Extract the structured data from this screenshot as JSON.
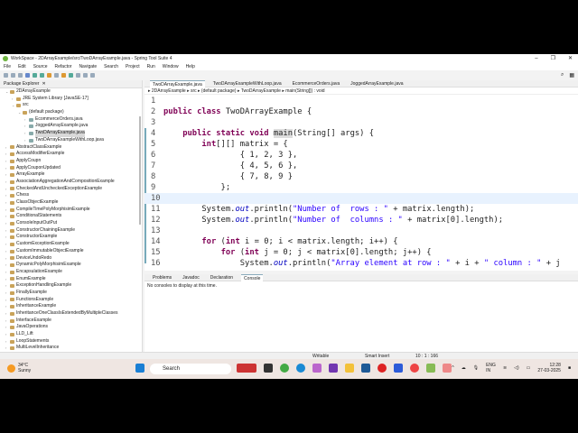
{
  "window": {
    "title": "WorkSpace - 2DArrayExample/src/TwoDArrayExample.java - Spring Tool Suite 4",
    "min": "–",
    "max": "❐",
    "close": "✕"
  },
  "menu": [
    "File",
    "Edit",
    "Source",
    "Refactor",
    "Navigate",
    "Search",
    "Project",
    "Run",
    "Window",
    "Help"
  ],
  "package_explorer": {
    "title": "Package Explorer",
    "close": "✕",
    "items": [
      {
        "label": "2DArrayExample",
        "level": 0,
        "open": true
      },
      {
        "label": "JRE System Library [JavaSE-17]",
        "level": 1
      },
      {
        "label": "src",
        "level": 1,
        "open": true
      },
      {
        "label": "(default package)",
        "level": 2,
        "open": true
      },
      {
        "label": "EcommerceOrders.java",
        "level": 3
      },
      {
        "label": "JoggedArrayExample.java",
        "level": 3
      },
      {
        "label": "TwoDArrayExample.java",
        "level": 3,
        "selected": true
      },
      {
        "label": "TwoDArrayExampleWithLoop.java",
        "level": 3
      },
      {
        "label": "AbstractClassExample",
        "level": 0
      },
      {
        "label": "AccessModifierExample",
        "level": 0
      },
      {
        "label": "ApplyCoupn",
        "level": 0
      },
      {
        "label": "ApplyCouponUpdated",
        "level": 0
      },
      {
        "label": "ArrayExample",
        "level": 0
      },
      {
        "label": "AssociationAggregationAndCompositionExample",
        "level": 0
      },
      {
        "label": "CheckedAndUncheckedExceptionExample",
        "level": 0
      },
      {
        "label": "Chess",
        "level": 0
      },
      {
        "label": "ClassObjectExample",
        "level": 0
      },
      {
        "label": "CompileTimePolyMorphisimExample",
        "level": 0
      },
      {
        "label": "ConditionalStatements",
        "level": 0
      },
      {
        "label": "ConsoleInputOutPut",
        "level": 0
      },
      {
        "label": "ConstructorChainingExample",
        "level": 0
      },
      {
        "label": "ConstructorExample",
        "level": 0
      },
      {
        "label": "CustomExceptionExample",
        "level": 0
      },
      {
        "label": "CustomImmutableObjectExample",
        "level": 0
      },
      {
        "label": "DeviceUndoRedo",
        "level": 0
      },
      {
        "label": "DynamicPolyMorphisimExample",
        "level": 0
      },
      {
        "label": "EncapsulationExample",
        "level": 0
      },
      {
        "label": "EnumExample",
        "level": 0
      },
      {
        "label": "ExceptionHandlingExample",
        "level": 0
      },
      {
        "label": "FinallyExample",
        "level": 0
      },
      {
        "label": "FunctionsExample",
        "level": 0
      },
      {
        "label": "InheritanceExample",
        "level": 0
      },
      {
        "label": "InheritanceOneClassIsExtendedByMultipleClasses",
        "level": 0
      },
      {
        "label": "InterfaceExample",
        "level": 0
      },
      {
        "label": "JavaOperations",
        "level": 0
      },
      {
        "label": "LLD_Lift",
        "level": 0
      },
      {
        "label": "LoopStatements",
        "level": 0
      },
      {
        "label": "MultiLevelInheritance",
        "level": 0
      }
    ]
  },
  "editor": {
    "tabs": [
      {
        "label": "TwoDArrayExample.java",
        "active": true
      },
      {
        "label": "TwoDArrayExampleWithLoop.java"
      },
      {
        "label": "EcommerceOrders.java"
      },
      {
        "label": "JoggedArrayExample.java"
      }
    ],
    "breadcrumb": "▸ 2DArrayExample ▸ src ▸ (default package) ▸ TwoDArrayExample ▸ main(String[]) : void",
    "lines": [
      "",
      "public class TwoDArrayExample {",
      "",
      "    public static void main(String[] args) {",
      "        int[][] matrix = {",
      "                { 1, 2, 3 },",
      "                { 4, 5, 6 },",
      "                { 7, 8, 9 }",
      "            };",
      "",
      "        System.out.println(\"Number of  rows : \" + matrix.length);",
      "        System.out.println(\"Number of  columns : \" + matrix[0].length);",
      "",
      "        for (int i = 0; i < matrix.length; i++) {",
      "            for (int j = 0; j < matrix[0].length; j++) {",
      "                System.out.println(\"Array element at row : \" + i + \" column : \" + j"
    ],
    "current_line": 10
  },
  "bottom": {
    "tabs": [
      "Problems",
      "Javadoc",
      "Declaration",
      "Console"
    ],
    "active": "Console",
    "message": "No consoles to display at this time."
  },
  "status": {
    "writable": "Writable",
    "insert": "Smart Insert",
    "position": "10 : 1 : 166"
  },
  "taskbar": {
    "temp": "34°C",
    "weather": "Sunny",
    "badge": "3",
    "search": "Search",
    "lang": "ENG",
    "region": "IN",
    "time": "12:28",
    "date": "27-03-2025"
  }
}
